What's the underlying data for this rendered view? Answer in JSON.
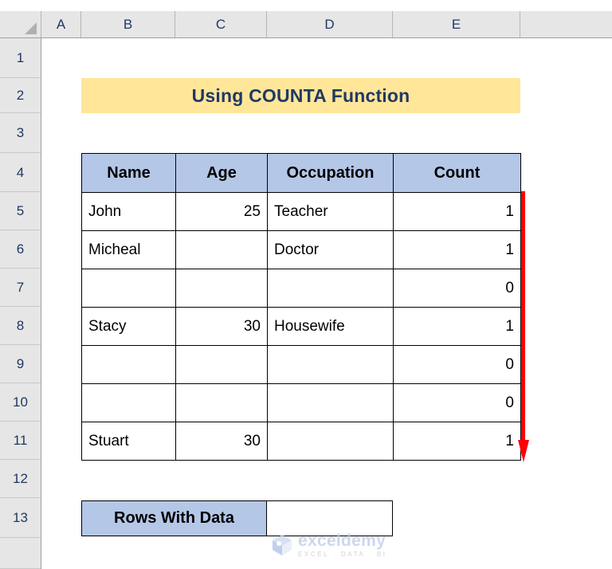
{
  "app": {
    "type": "spreadsheet"
  },
  "grid": {
    "column_headers": [
      "A",
      "B",
      "C",
      "D",
      "E"
    ],
    "row_headers": [
      "1",
      "2",
      "3",
      "4",
      "5",
      "6",
      "7",
      "8",
      "9",
      "10",
      "11",
      "12",
      "13"
    ],
    "select_all_icon": "select-all-triangle"
  },
  "title_banner": {
    "text": "Using COUNTA Function",
    "background": "#FFE699",
    "text_color": "#213864"
  },
  "table": {
    "header_background": "#B4C7E7",
    "headers": [
      "Name",
      "Age",
      "Occupation",
      "Count"
    ],
    "rows": [
      {
        "name": "John",
        "age": "25",
        "occupation": "Teacher",
        "count": "1"
      },
      {
        "name": "Micheal",
        "age": "",
        "occupation": "Doctor",
        "count": "1"
      },
      {
        "name": "",
        "age": "",
        "occupation": "",
        "count": "0"
      },
      {
        "name": "Stacy",
        "age": "30",
        "occupation": "Housewife",
        "count": "1"
      },
      {
        "name": "",
        "age": "",
        "occupation": "",
        "count": "0"
      },
      {
        "name": "",
        "age": "",
        "occupation": "",
        "count": "0"
      },
      {
        "name": "Stuart",
        "age": "30",
        "occupation": "",
        "count": "1"
      }
    ]
  },
  "annotation": {
    "arrow_color": "#FB0007",
    "arrow_direction": "down",
    "icon": "down-arrow-icon"
  },
  "summary": {
    "label": "Rows With Data",
    "value": "",
    "label_background": "#B4C7E7"
  },
  "watermark": {
    "brand": "exceldemy",
    "tagline": "EXCEL · DATA · BI",
    "brand_color": "#B9C8EA"
  }
}
